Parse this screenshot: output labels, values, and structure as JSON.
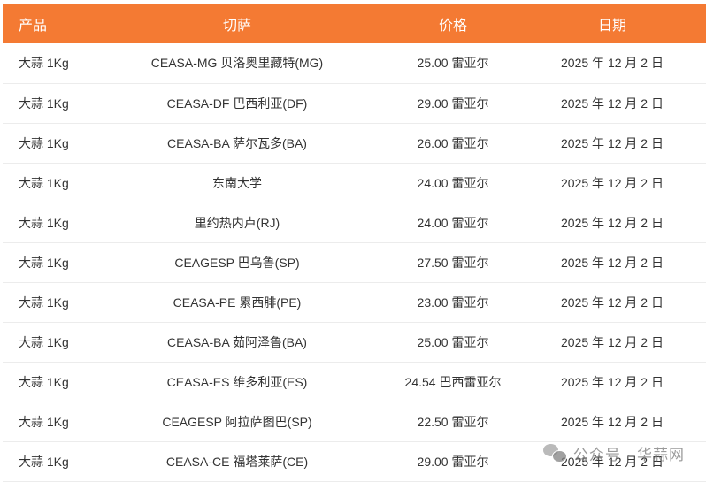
{
  "table": {
    "headers": [
      "产品",
      "切萨",
      "价格",
      "日期"
    ],
    "rows": [
      [
        "大蒜 1Kg",
        "CEASA-MG 贝洛奥里藏特(MG)",
        "25.00 雷亚尔",
        "2025 年 12 月 2 日"
      ],
      [
        "大蒜 1Kg",
        "CEASA-DF 巴西利亚(DF)",
        "29.00 雷亚尔",
        "2025 年 12 月 2 日"
      ],
      [
        "大蒜 1Kg",
        "CEASA-BA 萨尔瓦多(BA)",
        "26.00 雷亚尔",
        "2025 年 12 月 2 日"
      ],
      [
        "大蒜 1Kg",
        "东南大学",
        "24.00 雷亚尔",
        "2025 年 12 月 2 日"
      ],
      [
        "大蒜 1Kg",
        "里约热内卢(RJ)",
        "24.00 雷亚尔",
        "2025 年 12 月 2 日"
      ],
      [
        "大蒜 1Kg",
        "CEAGESP 巴乌鲁(SP)",
        "27.50 雷亚尔",
        "2025 年 12 月 2 日"
      ],
      [
        "大蒜 1Kg",
        "CEASA-PE 累西腓(PE)",
        "23.00 雷亚尔",
        "2025 年 12 月 2 日"
      ],
      [
        "大蒜 1Kg",
        "CEASA-BA 茹阿泽鲁(BA)",
        "25.00 雷亚尔",
        "2025 年 12 月 2 日"
      ],
      [
        "大蒜 1Kg",
        "CEASA-ES 维多利亚(ES)",
        "24.54 巴西雷亚尔",
        "2025 年 12 月 2 日"
      ],
      [
        "大蒜 1Kg",
        "CEAGESP 阿拉萨图巴(SP)",
        "22.50 雷亚尔",
        "2025 年 12 月 2 日"
      ],
      [
        "大蒜 1Kg",
        "CEASA-CE 福塔莱萨(CE)",
        "29.00 雷亚尔",
        "2025 年 12 月 2 日"
      ]
    ]
  },
  "watermark": {
    "text": "公众号 · 华蒜网",
    "icon": "wechat-icon"
  },
  "colors": {
    "header_bg": "#f47a33",
    "header_text": "#ffffff",
    "row_border": "#ececec"
  }
}
